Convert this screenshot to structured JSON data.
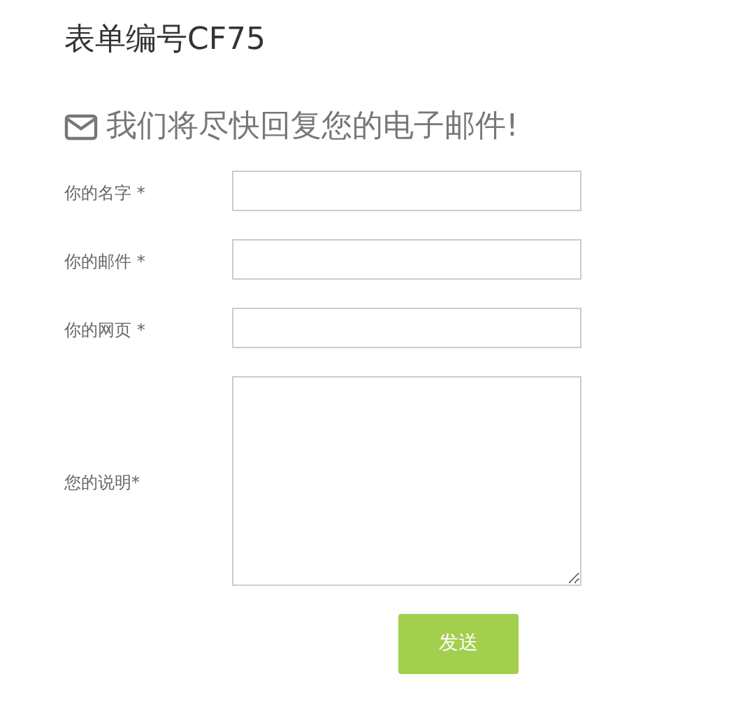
{
  "title": "表单编号CF75",
  "subtitle": "我们将尽快回复您的电子邮件!",
  "fields": [
    {
      "label": "你的名字 *",
      "kind": "input"
    },
    {
      "label": "你的邮件 *",
      "kind": "input"
    },
    {
      "label": "你的网页 *",
      "kind": "input"
    },
    {
      "label": "您的说明*",
      "kind": "textarea"
    }
  ],
  "submit": "发送"
}
